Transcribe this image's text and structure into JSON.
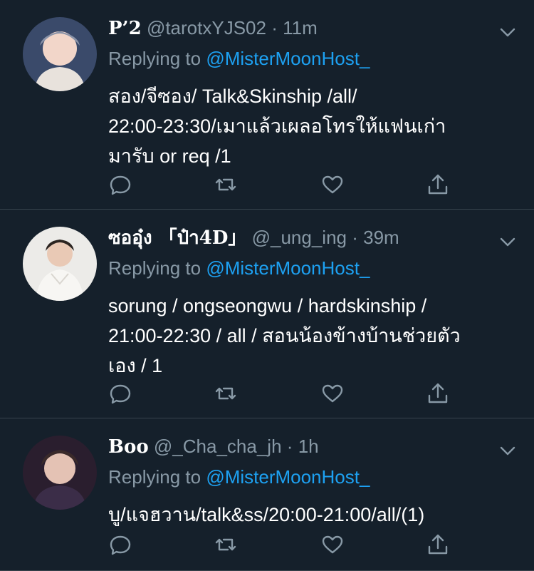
{
  "colors": {
    "background": "#15202b",
    "secondary_text": "#8899a6",
    "accent": "#1da1f2",
    "divider": "#38444d"
  },
  "tweets": [
    {
      "name": "P’2",
      "handle": "@tarotxYJS02",
      "separator": "·",
      "time": "11m",
      "replying_prefix": "Replying to",
      "replying_to": "@MisterMoonHost_",
      "text": "สอง/จีซอง/ Talk&Skinship /all/\n22:00-23:30/เมาแล้วเผลอโทรให้แฟนเก่า\nมารับ or req /1",
      "icons": [
        "reply-icon",
        "retweet-icon",
        "like-icon",
        "share-icon",
        "chevron-down-icon"
      ]
    },
    {
      "name": "ซออุ๋ง 「ป๋า4D」",
      "handle": "@_ung_ing",
      "separator": "·",
      "time": "39m",
      "replying_prefix": "Replying to",
      "replying_to": "@MisterMoonHost_",
      "text": "sorung / ongseongwu / hardskinship /\n21:00-22:30 / all / สอนน้องข้างบ้านช่วยตัว\nเอง / 1",
      "icons": [
        "reply-icon",
        "retweet-icon",
        "like-icon",
        "share-icon",
        "chevron-down-icon"
      ]
    },
    {
      "name": "Boo",
      "handle": "@_Cha_cha_jh",
      "separator": "·",
      "time": "1h",
      "replying_prefix": "Replying to",
      "replying_to": "@MisterMoonHost_",
      "text": "บู/แจฮวาน/talk&ss/20:00-21:00/all/(1)",
      "icons": [
        "reply-icon",
        "retweet-icon",
        "like-icon",
        "share-icon",
        "chevron-down-icon"
      ]
    }
  ]
}
